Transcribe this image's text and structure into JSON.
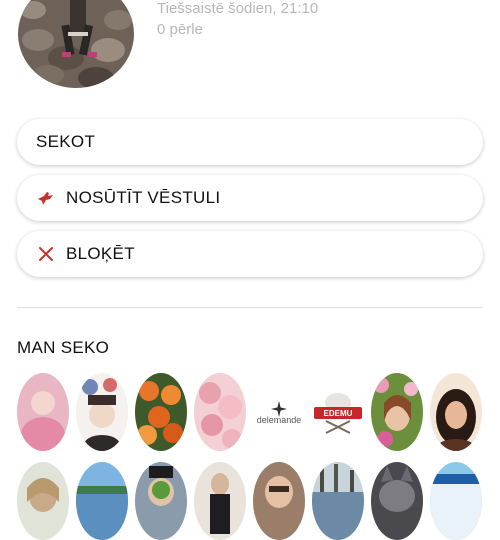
{
  "profile": {
    "online_status": "Tiešsaistē šodien, 21:10",
    "pearls": "0 pērle"
  },
  "actions": {
    "follow_label": "SEKOT",
    "send_letter_label": "NOSŪTĪT VĒSTULI",
    "block_label": "BLOĶĒT"
  },
  "followers_section": {
    "title": "MAN SEKO",
    "logo_text": "delemande",
    "badge_text": "EDEMU"
  },
  "colors": {
    "accent_red": "#c9302c",
    "status_gray": "#b7b7b7"
  },
  "icons": {
    "send_letter": "pigeon-icon",
    "block": "close-icon"
  }
}
